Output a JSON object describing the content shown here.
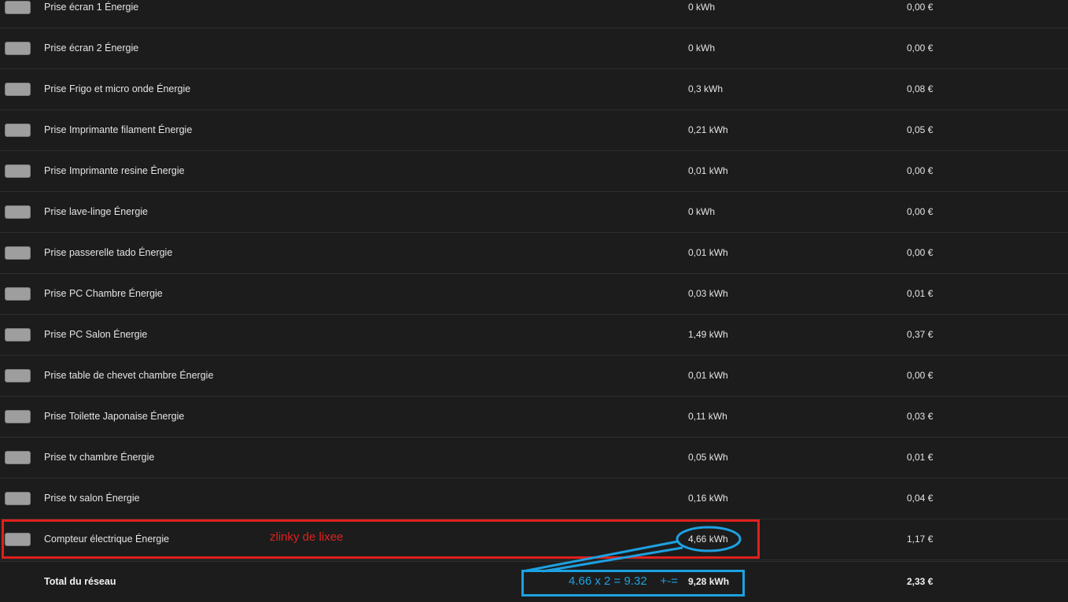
{
  "rows": [
    {
      "name": "Prise écran 1 Énergie",
      "kwh": "0 kWh",
      "cost": "0,00 €"
    },
    {
      "name": "Prise écran 2 Énergie",
      "kwh": "0 kWh",
      "cost": "0,00 €"
    },
    {
      "name": "Prise Frigo et micro onde Énergie",
      "kwh": "0,3 kWh",
      "cost": "0,08 €"
    },
    {
      "name": "Prise Imprimante filament Énergie",
      "kwh": "0,21 kWh",
      "cost": "0,05 €"
    },
    {
      "name": "Prise Imprimante resine Énergie",
      "kwh": "0,01 kWh",
      "cost": "0,00 €"
    },
    {
      "name": "Prise lave-linge Énergie",
      "kwh": "0 kWh",
      "cost": "0,00 €"
    },
    {
      "name": "Prise passerelle tado Énergie",
      "kwh": "0,01 kWh",
      "cost": "0,00 €"
    },
    {
      "name": "Prise PC Chambre Énergie",
      "kwh": "0,03 kWh",
      "cost": "0,01 €"
    },
    {
      "name": "Prise PC Salon Énergie",
      "kwh": "1,49 kWh",
      "cost": "0,37 €"
    },
    {
      "name": "Prise table de chevet chambre Énergie",
      "kwh": "0,01 kWh",
      "cost": "0,00 €"
    },
    {
      "name": "Prise Toilette Japonaise Énergie",
      "kwh": "0,11 kWh",
      "cost": "0,03 €"
    },
    {
      "name": "Prise tv chambre Énergie",
      "kwh": "0,05 kWh",
      "cost": "0,01 €"
    },
    {
      "name": "Prise tv salon Énergie",
      "kwh": "0,16 kWh",
      "cost": "0,04 €"
    },
    {
      "name": "Compteur électrique Énergie",
      "kwh": "4,66 kWh",
      "cost": "1,17 €"
    }
  ],
  "total": {
    "name": "Total du réseau",
    "kwh": "9,28 kWh",
    "cost": "2,33 €"
  },
  "annotations": {
    "red_note": "zlinky de lixee",
    "blue_note": "4.66 x 2 = 9.32    +-=",
    "red_color": "#e0201c",
    "blue_color": "#1da1e2"
  },
  "colors": {
    "background": "#1c1c1c",
    "swatch": "#9e9e9e",
    "divider": "#2e2e2e"
  }
}
